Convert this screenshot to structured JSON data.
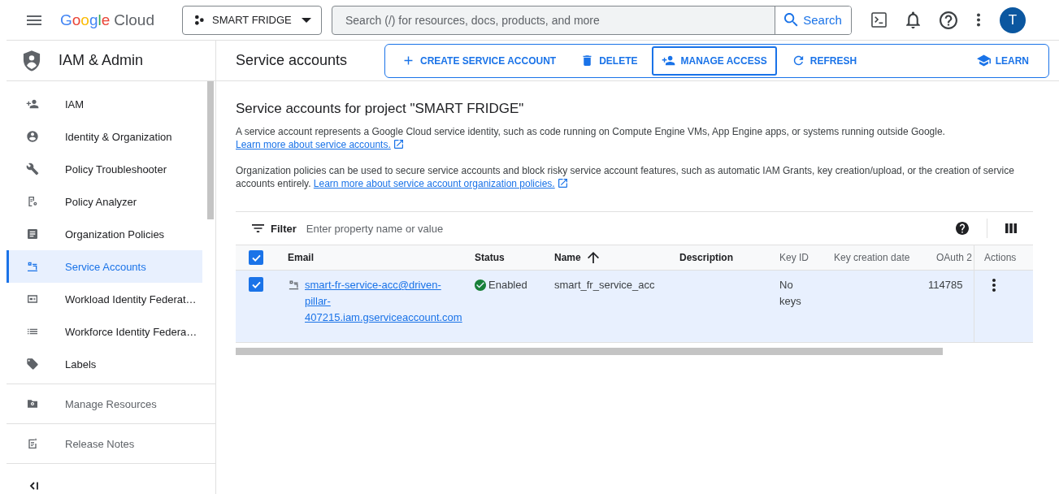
{
  "header": {
    "brand": {
      "word": "Google",
      "product": "Cloud"
    },
    "project": "SMART FRIDGE",
    "search": {
      "placeholder": "Search (/) for resources, docs, products, and more",
      "button": "Search"
    },
    "avatar": "T"
  },
  "sidebar": {
    "title": "IAM & Admin",
    "items": [
      {
        "label": "IAM",
        "selected": false
      },
      {
        "label": "Identity & Organization",
        "selected": false
      },
      {
        "label": "Policy Troubleshooter",
        "selected": false
      },
      {
        "label": "Policy Analyzer",
        "selected": false
      },
      {
        "label": "Organization Policies",
        "selected": false
      },
      {
        "label": "Service Accounts",
        "selected": true
      },
      {
        "label": "Workload Identity Federat…",
        "selected": false
      },
      {
        "label": "Workforce Identity Federa…",
        "selected": false
      },
      {
        "label": "Labels",
        "selected": false
      }
    ],
    "footer_items": [
      {
        "label": "Manage Resources"
      },
      {
        "label": "Release Notes"
      }
    ]
  },
  "page": {
    "title": "Service accounts",
    "toolbar": [
      {
        "label": "CREATE SERVICE ACCOUNT",
        "focused": false
      },
      {
        "label": "DELETE",
        "focused": false
      },
      {
        "label": "MANAGE ACCESS",
        "focused": true
      },
      {
        "label": "REFRESH",
        "focused": false
      }
    ],
    "learn": "LEARN"
  },
  "content": {
    "heading": "Service accounts for project \"SMART FRIDGE\"",
    "paragraphs": [
      {
        "text": "A service account represents a Google Cloud service identity, such as code running on Compute Engine VMs, App Engine apps, or systems running outside Google.",
        "link": "Learn more about service accounts."
      },
      {
        "text": "Organization policies can be used to secure service accounts and block risky service account features, such as automatic IAM Grants, key creation/upload, or the creation of service accounts entirely.",
        "link": "Learn more about service account organization policies."
      }
    ]
  },
  "table": {
    "filter": {
      "label": "Filter",
      "placeholder": "Enter property name or value"
    },
    "select_all_checked": true,
    "columns": [
      {
        "label": "Email",
        "sorted": false
      },
      {
        "label": "Status",
        "sorted": false
      },
      {
        "label": "Name",
        "sorted": true
      },
      {
        "label": "Description",
        "sorted": false
      },
      {
        "label": "Key ID",
        "sorted": false
      },
      {
        "label": "Key creation date",
        "sorted": false
      },
      {
        "label": "OAuth 2",
        "sorted": false
      },
      {
        "label": "Actions",
        "sorted": false
      }
    ],
    "rows": [
      {
        "checked": true,
        "email": "smart-fr-service-acc@driven-pillar-407215.iam.gserviceaccount.com",
        "status": "Enabled",
        "name": "smart_fr_service_acc",
        "key_id": "No keys",
        "oauth": "114785"
      }
    ]
  }
}
